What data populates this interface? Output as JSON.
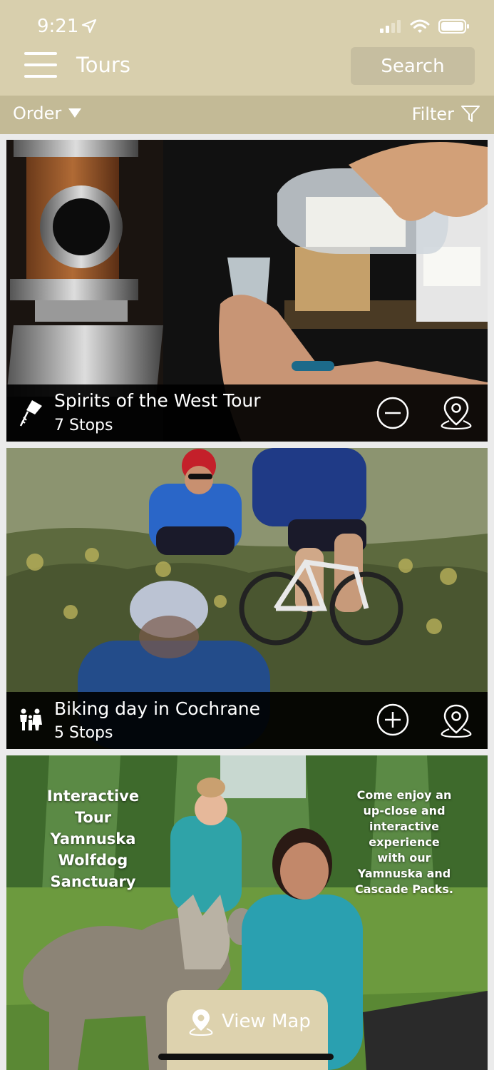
{
  "status_bar": {
    "time": "9:21"
  },
  "header": {
    "title": "Tours",
    "search_label": "Search"
  },
  "toolbar": {
    "order_label": "Order",
    "filter_label": "Filter"
  },
  "tours": [
    {
      "title": "Spirits of the West Tour",
      "stops": "7 Stops",
      "category_icon": "kite-icon",
      "action_icon": "minus-circle-icon",
      "map_icon": "map-pin-icon"
    },
    {
      "title": "Biking day in Cochrane",
      "stops": "5 Stops",
      "category_icon": "family-icon",
      "action_icon": "plus-circle-icon",
      "map_icon": "map-pin-icon"
    },
    {
      "overlay_left": [
        "Interactive",
        "Tour",
        "Yamnuska",
        "Wolfdog",
        "Sanctuary"
      ],
      "overlay_right": [
        "Come enjoy an",
        "up-close and",
        "interactive",
        "experience",
        "with our",
        "Yamnuska and",
        "Cascade Packs."
      ]
    }
  ],
  "bottom": {
    "view_map_label": "View Map"
  },
  "colors": {
    "header_bg": "#d8cfad",
    "toolbar_bg": "#c3ba96",
    "search_btn": "#c6bea0",
    "view_map_bg": "#ddd2ae"
  }
}
